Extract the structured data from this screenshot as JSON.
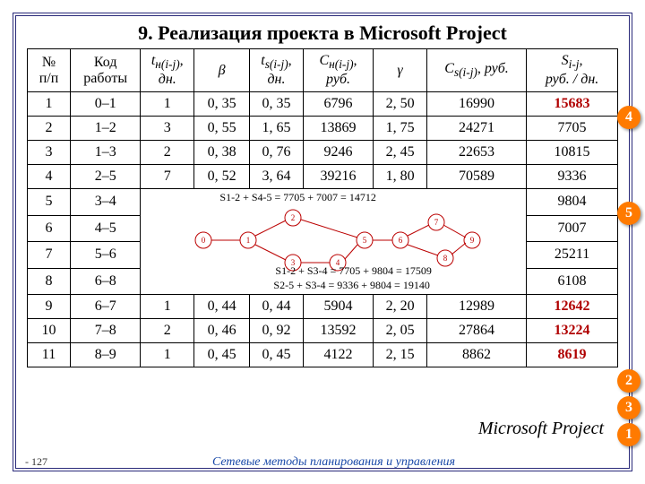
{
  "title": "9. Реализация проекта в Microsoft Project",
  "header": {
    "np": "№\nп/п",
    "code": "Код\nработы",
    "tn": "tн(i-j),\nдн.",
    "beta": "β",
    "ts": "ts(i-j),\nдн.",
    "cn": "Cн(i-j),\nруб.",
    "gamma": "γ",
    "cs": "Cs(i-j), руб.",
    "s": "Si-j,\nруб. / дн."
  },
  "rows": [
    {
      "n": "1",
      "code": "0–1",
      "tn": "1",
      "b": "0, 35",
      "ts": "0, 35",
      "cn": "6796",
      "g": "2, 50",
      "cs": "16990",
      "s": "15683",
      "red": true
    },
    {
      "n": "2",
      "code": "1–2",
      "tn": "3",
      "b": "0, 55",
      "ts": "1, 65",
      "cn": "13869",
      "g": "1, 75",
      "cs": "24271",
      "s": "7705",
      "red": false
    },
    {
      "n": "3",
      "code": "1–3",
      "tn": "2",
      "b": "0, 38",
      "ts": "0, 76",
      "cn": "9246",
      "g": "2, 45",
      "cs": "22653",
      "s": "10815",
      "red": false
    },
    {
      "n": "4",
      "code": "2–5",
      "tn": "7",
      "b": "0, 52",
      "ts": "3, 64",
      "cn": "39216",
      "g": "1, 80",
      "cs": "70589",
      "s": "9336",
      "red": false
    }
  ],
  "midrows": [
    {
      "n": "5",
      "code": "3–4",
      "s": "9804"
    },
    {
      "n": "6",
      "code": "4–5",
      "s": "7007"
    },
    {
      "n": "7",
      "code": "5–6",
      "s": "25211"
    },
    {
      "n": "8",
      "code": "6–8",
      "s": "6108"
    }
  ],
  "diagram": {
    "eq1": "S1-2 + S4-5 = 7705 + 7007 = 14712",
    "eq2": "S1-2 + S3-4 = 7705 + 9804 = 17509",
    "eq3": "S2-5 + S3-4 = 9336 + 9804 = 19140"
  },
  "rows2": [
    {
      "n": "9",
      "code": "6–7",
      "tn": "1",
      "b": "0, 44",
      "ts": "0, 44",
      "cn": "5904",
      "g": "2, 20",
      "cs": "12989",
      "s": "12642",
      "red": true
    },
    {
      "n": "10",
      "code": "7–8",
      "tn": "2",
      "b": "0, 46",
      "ts": "0, 92",
      "cn": "13592",
      "g": "2, 05",
      "cs": "27864",
      "s": "13224",
      "red": true
    },
    {
      "n": "11",
      "code": "8–9",
      "tn": "1",
      "b": "0, 45",
      "ts": "0, 45",
      "cn": "4122",
      "g": "2, 15",
      "cs": "8862",
      "s": "8619",
      "red": true
    }
  ],
  "badges": {
    "b1": "1",
    "b2": "2",
    "b3": "3",
    "b4": "4",
    "b5": "5"
  },
  "footer": {
    "page": "- 127",
    "subtitle": "Сетевые методы планирования и управления"
  },
  "mp": "Microsoft Project",
  "chart_data": {
    "type": "table",
    "title": "Реализация проекта в Microsoft Project",
    "columns": [
      "№ п/п",
      "Код работы",
      "tн(i-j), дн.",
      "β",
      "ts(i-j), дн.",
      "Cн(i-j), руб.",
      "γ",
      "Cs(i-j), руб.",
      "Si-j, руб./дн."
    ],
    "rows": [
      [
        1,
        "0–1",
        1,
        0.35,
        0.35,
        6796,
        2.5,
        16990,
        15683
      ],
      [
        2,
        "1–2",
        3,
        0.55,
        1.65,
        13869,
        1.75,
        24271,
        7705
      ],
      [
        3,
        "1–3",
        2,
        0.38,
        0.76,
        9246,
        2.45,
        22653,
        10815
      ],
      [
        4,
        "2–5",
        7,
        0.52,
        3.64,
        39216,
        1.8,
        70589,
        9336
      ],
      [
        5,
        "3–4",
        null,
        null,
        null,
        null,
        null,
        null,
        9804
      ],
      [
        6,
        "4–5",
        null,
        null,
        null,
        null,
        null,
        null,
        7007
      ],
      [
        7,
        "5–6",
        null,
        null,
        null,
        null,
        null,
        null,
        25211
      ],
      [
        8,
        "6–8",
        null,
        null,
        null,
        null,
        null,
        null,
        6108
      ],
      [
        9,
        "6–7",
        1,
        0.44,
        0.44,
        5904,
        2.2,
        12989,
        12642
      ],
      [
        10,
        "7–8",
        2,
        0.46,
        0.92,
        13592,
        2.05,
        27864,
        13224
      ],
      [
        11,
        "8–9",
        1,
        0.45,
        0.45,
        4122,
        2.15,
        8862,
        8619
      ]
    ],
    "annotations": [
      "S1-2 + S4-5 = 7705 + 7007 = 14712",
      "S1-2 + S3-4 = 7705 + 9804 = 17509",
      "S2-5 + S3-4 = 9336 + 9804 = 19140"
    ]
  }
}
